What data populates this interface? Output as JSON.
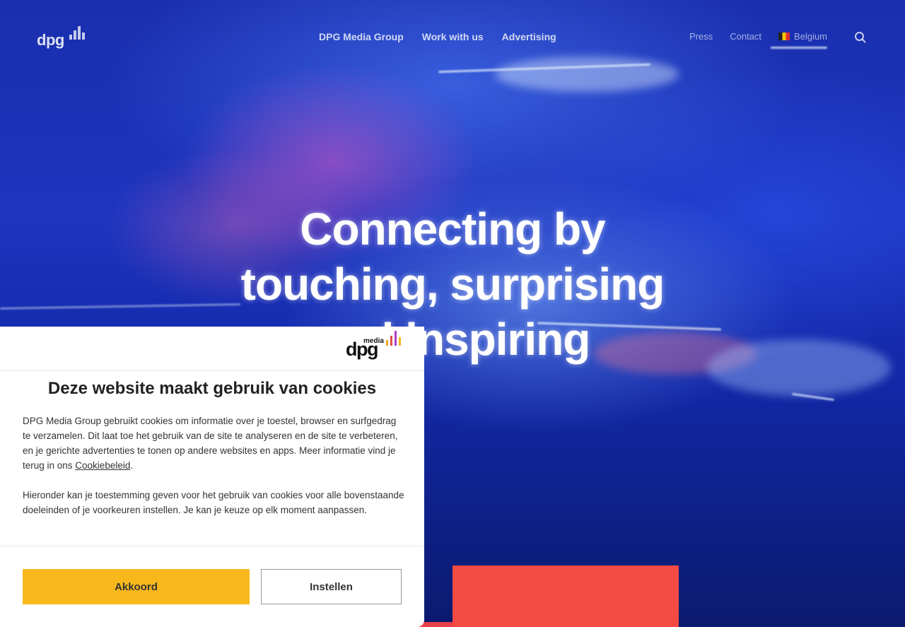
{
  "nav": {
    "logo_text": "dpg",
    "main_links": [
      "DPG Media Group",
      "Work with us",
      "Advertising"
    ],
    "press": "Press",
    "contact": "Contact",
    "country": "Belgium",
    "search_icon": "search-icon"
  },
  "hero": {
    "title_line1": "Connecting by",
    "title_line2": "touching, surprising",
    "title_line3": "and inspiring"
  },
  "cookie": {
    "logo_small": "media",
    "logo_word": "dpg",
    "title": "Deze website maakt gebruik van cookies",
    "p1_text": "DPG Media Group gebruikt cookies om informatie over je toestel, browser en surfgedrag te verzamelen. Dit laat toe het gebruik van de site te analyseren en de site te verbeteren, en je gerichte advertenties te tonen op andere websites en apps. Meer informatie vind je terug in ons ",
    "p1_link": "Cookiebeleid",
    "p1_end": ".",
    "p2": "Hieronder kan je toestemming geven voor het gebruik van cookies voor alle bovenstaande doeleinden of je voorkeuren instellen. Je kan je keuze op elk moment aanpassen.",
    "accept_label": "Akkoord",
    "settings_label": "Instellen",
    "accept_color": "#f8b81c"
  }
}
